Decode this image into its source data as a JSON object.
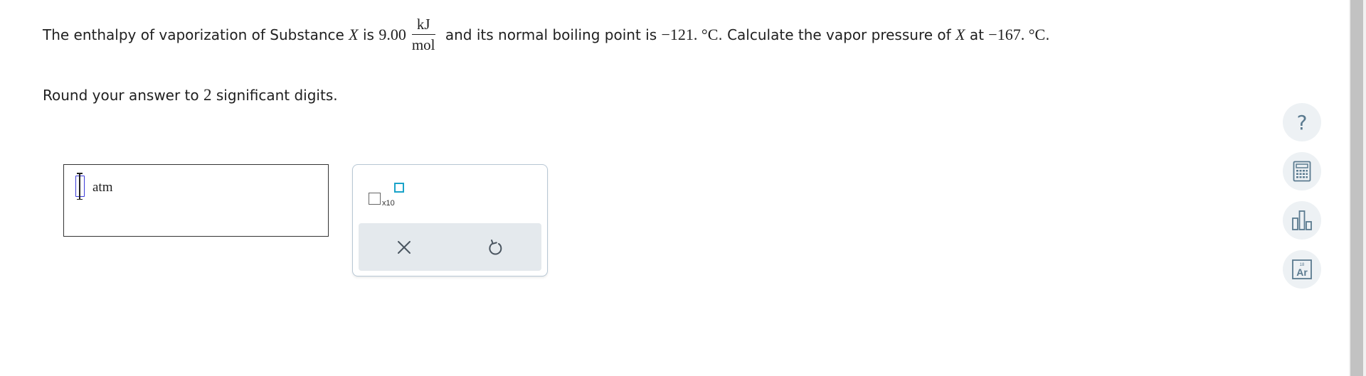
{
  "question": {
    "t1": "The enthalpy of vaporization of Substance ",
    "sub1": "X",
    "t2": " is ",
    "value": "9.00",
    "frac_num": "kJ",
    "frac_den": "mol",
    "t3": " and its normal boiling point is ",
    "bp": "−121. °C",
    "t4": ". Calculate the vapor pressure of ",
    "sub2": "X",
    "t5": " at ",
    "temp": "−167. °C",
    "t6": "."
  },
  "rounding": {
    "t1": "Round your answer to ",
    "digits": "2",
    "t2": " significant digits."
  },
  "answer": {
    "value": "",
    "unit": "atm"
  },
  "palette": {
    "sci_label": "x10"
  },
  "sidebar": {
    "help": "?",
    "periodic_number": "18",
    "periodic_symbol": "Ar"
  }
}
